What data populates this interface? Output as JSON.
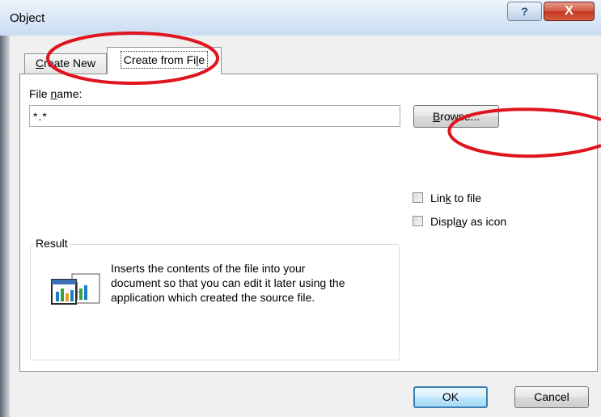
{
  "window": {
    "title": "Object",
    "help_label": "?",
    "close_label": "X"
  },
  "tabs": [
    {
      "pre": "",
      "accel": "C",
      "post": "reate New",
      "selected": false
    },
    {
      "pre": "Create from Fi",
      "accel": "l",
      "post": "e",
      "selected": true
    }
  ],
  "file_name": {
    "label_pre": "File ",
    "label_accel": "n",
    "label_post": "ame:",
    "value": "*.*"
  },
  "browse_button": {
    "accel": "B",
    "post": "rowse..."
  },
  "options": {
    "link_to_file": {
      "pre": "Lin",
      "accel": "k",
      "post": " to file",
      "checked": false
    },
    "display_as_icon": {
      "pre": "Displ",
      "accel": "a",
      "post": "y as icon",
      "checked": false
    }
  },
  "result": {
    "legend": "Result",
    "line1": "Inserts the contents of the file into your",
    "line2": "document so that you can edit it later using the",
    "line3": "application which created the source file."
  },
  "footer": {
    "ok_label": "OK",
    "cancel_label": "Cancel"
  },
  "colors": {
    "annotation_red": "#e0141e",
    "ok_border": "#3c7fb1",
    "panel_border": "#8e8f8f"
  },
  "icons": [
    "help-icon",
    "close-icon",
    "object-document-icon"
  ]
}
